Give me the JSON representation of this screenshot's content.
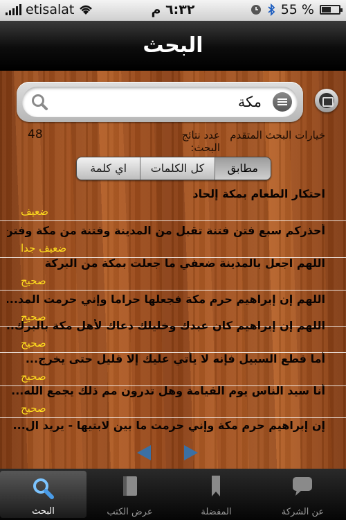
{
  "status_bar": {
    "carrier": "etisalat",
    "time": "٦:٣٢ م",
    "battery": "55 %",
    "battery_level": 0.55,
    "icons": [
      "signal-icon",
      "wifi-icon",
      "clock-icon",
      "bluetooth-icon",
      "battery-icon"
    ]
  },
  "nav": {
    "title": "البحث"
  },
  "search": {
    "value": "مكة",
    "icons": [
      "search-icon",
      "list-icon",
      "photo-icon"
    ]
  },
  "options": {
    "advanced_label": "خيارات البحث المتقدم",
    "results_label": "عدد نتائج البحث:",
    "results_count": "48"
  },
  "segments": [
    {
      "label": "مطابق",
      "active": true
    },
    {
      "label": "كل الكلمات",
      "active": false
    },
    {
      "label": "اي كلمة",
      "active": false
    }
  ],
  "results": [
    {
      "title": "احتكار الطعام بمكة إلحاد",
      "grade": "ضعيف"
    },
    {
      "title": "أحذركم سبع فتن فتنة تقبل من المدينة وفتنة من مكة وفتن...",
      "grade": "ضعيف جدا"
    },
    {
      "title": "اللهم اجعل بالمدينة ضعفي ما جعلت بمكة من البركة",
      "grade": "صحيح"
    },
    {
      "title": "اللهم إن إبراهيم حرم مكة فجعلها حراما وإني حرمت المد...",
      "grade": "صحيح"
    },
    {
      "title": "اللهم إن إبراهيم كان عبدك وخليلك دعاك لأهل مكة بالبرك...",
      "grade": "صحيح"
    },
    {
      "title": "أما قطع السبيل فإنه لا يأتي عليك إلا قليل حتى يخرج...",
      "grade": "صحيح"
    },
    {
      "title": "أنا سيد الناس يوم القيامة وهل تدرون مم ذلك يجمع الله...",
      "grade": "صحيح"
    },
    {
      "title": "إن إبراهيم حرم مكة وإني حرمت ما بين لابتيها - يريد ال...",
      "grade": ""
    }
  ],
  "pagination": {
    "prev_icon": "left-arrow-icon",
    "next_icon": "right-arrow-icon"
  },
  "tabs": [
    {
      "label": "البحث",
      "icon": "search-icon",
      "active": true
    },
    {
      "label": "عرض الكتب",
      "icon": "book-icon",
      "active": false
    },
    {
      "label": "المفضلة",
      "icon": "bookmark-icon",
      "active": false
    },
    {
      "label": "عن الشركة",
      "icon": "speech-bubble-icon",
      "active": false
    }
  ],
  "colors": {
    "grade_text": "#ffde1e",
    "arrow": "#3b70a4",
    "nav_bar": "#111111"
  }
}
